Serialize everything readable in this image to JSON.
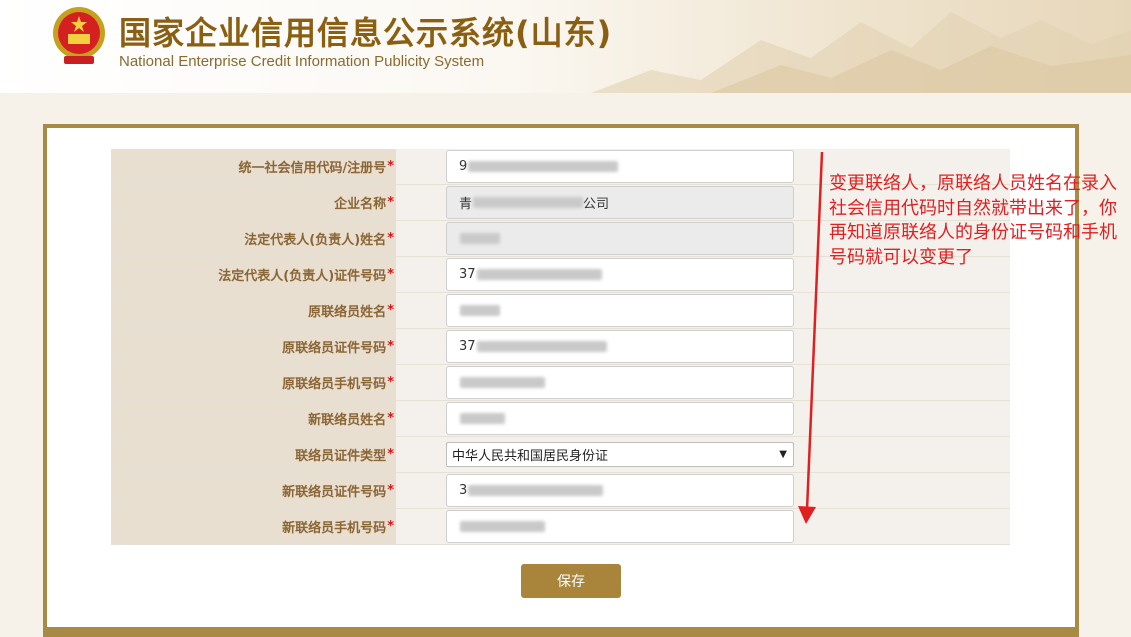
{
  "header": {
    "title": "国家企业信用信息公示系统(山东)",
    "subtitle": "National Enterprise Credit Information Publicity System"
  },
  "form": {
    "rows": [
      {
        "label": "统一社会信用代码/注册号",
        "value": "9",
        "readonly": false
      },
      {
        "label": "企业名称",
        "value_prefix": "青",
        "value_suffix": "公司",
        "readonly": true
      },
      {
        "label": "法定代表人(负责人)姓名",
        "value": "",
        "readonly": true
      },
      {
        "label": "法定代表人(负责人)证件号码",
        "value": "37",
        "readonly": false
      },
      {
        "label": "原联络员姓名",
        "value": "",
        "readonly": false
      },
      {
        "label": "原联络员证件号码",
        "value": "37",
        "readonly": false
      },
      {
        "label": "原联络员手机号码",
        "value": "",
        "readonly": false
      },
      {
        "label": "新联络员姓名",
        "value": "",
        "readonly": false
      },
      {
        "label": "联络员证件类型",
        "selected": "中华人民共和国居民身份证"
      },
      {
        "label": "新联络员证件号码",
        "value": "3",
        "readonly": false
      },
      {
        "label": "新联络员手机号码",
        "value": "",
        "readonly": false
      }
    ],
    "required_mark": "*"
  },
  "save_label": "保存",
  "annotation": {
    "text": "变更联络人，原联络人员姓名在录入社会信用代码时自然就带出来了，你再知道原联络人的身份证号码和手机号码就可以变更了",
    "color": "#e02020"
  },
  "colors": {
    "brand": "#8a5f12",
    "label_bg": "#e9dfd0",
    "label_text": "#8a6535",
    "button": "#a8853a"
  }
}
